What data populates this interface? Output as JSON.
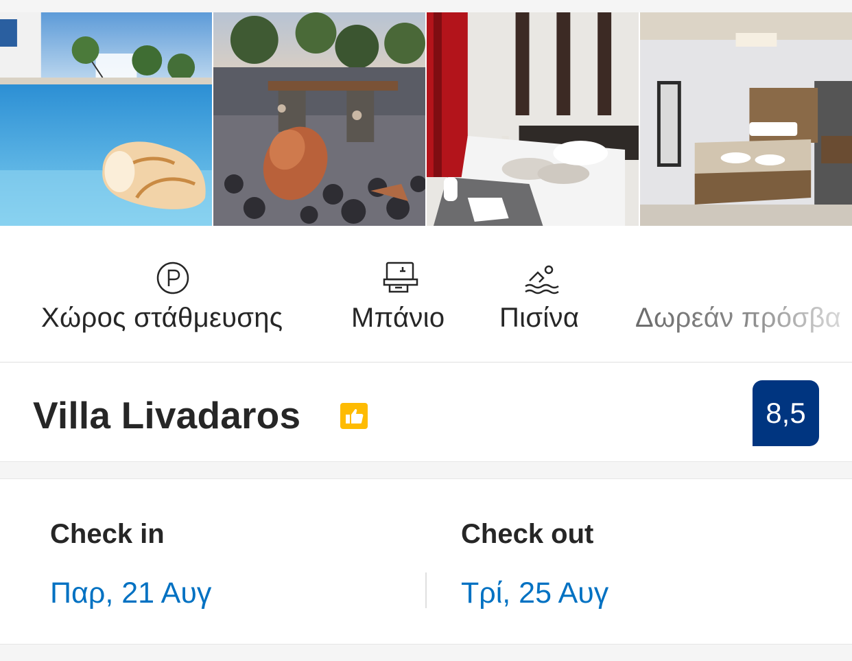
{
  "gallery": {
    "photos": [
      {
        "icon": "pool-shell-photo"
      },
      {
        "icon": "garden-amphora-photo"
      },
      {
        "icon": "bedroom-red-curtain-photo"
      },
      {
        "icon": "bedroom-wood-headboard-photo"
      }
    ]
  },
  "facilities": [
    {
      "label": "Χώρος στάθμευσης",
      "icon": "parking-icon"
    },
    {
      "label": "Μπάνιο",
      "icon": "bathroom-sink-icon"
    },
    {
      "label": "Πισίνα",
      "icon": "swimming-icon"
    },
    {
      "label": "Δωρεάν πρόσβα",
      "icon": "none"
    }
  ],
  "hotel": {
    "name": "Villa Livadaros",
    "preferred_icon": "thumbs-up-icon",
    "score": "8,5"
  },
  "dates": {
    "checkin_label": "Check in",
    "checkin_value": "Παρ, 21 Αυγ",
    "checkout_label": "Check out",
    "checkout_value": "Τρί, 25 Αυγ"
  },
  "colors": {
    "brand_blue": "#003580",
    "link_blue": "#0071c2",
    "preferred_yellow": "#febb02",
    "text": "#262626"
  }
}
